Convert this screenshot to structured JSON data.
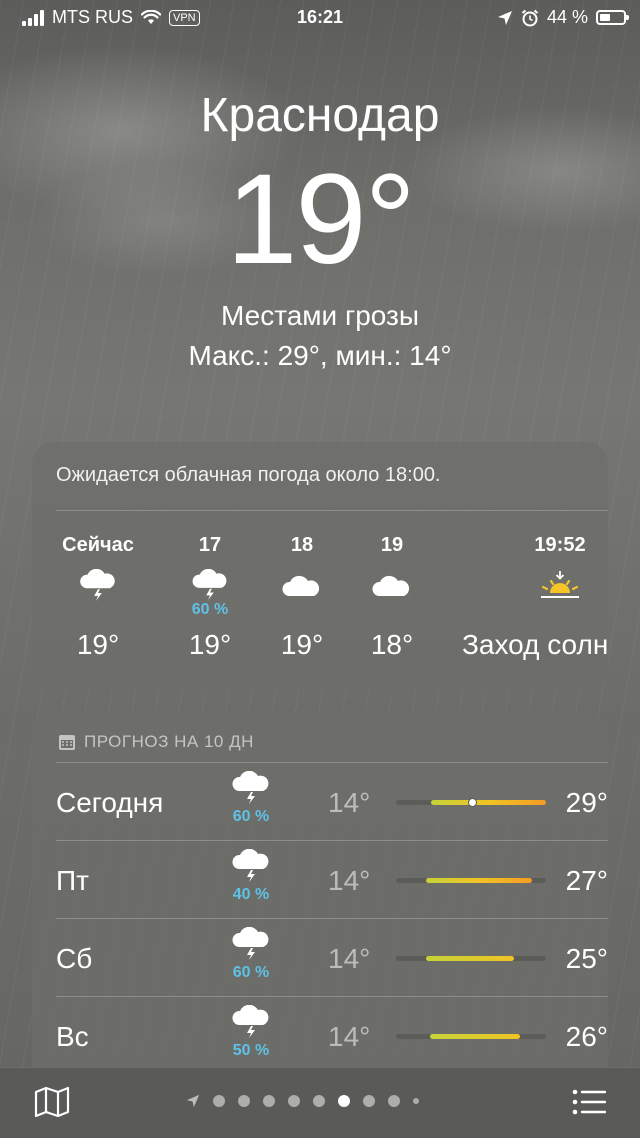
{
  "status": {
    "carrier": "MTS RUS",
    "vpn": "VPN",
    "time": "16:21",
    "battery": "44 %"
  },
  "current": {
    "city": "Краснодар",
    "temp": "19°",
    "condition": "Местами грозы",
    "hilo": "Макс.: 29°, мин.: 14°"
  },
  "hourly": {
    "summary": "Ожидается облачная погода около 18:00.",
    "items": [
      {
        "time": "Сейчас",
        "icon": "thunder-cloud-icon",
        "precip": "",
        "temp": "19°"
      },
      {
        "time": "17",
        "icon": "thunder-cloud-icon",
        "precip": "60 %",
        "temp": "19°"
      },
      {
        "time": "18",
        "icon": "cloud-icon",
        "precip": "",
        "temp": "19°"
      },
      {
        "time": "19",
        "icon": "cloud-icon",
        "precip": "",
        "temp": "18°"
      },
      {
        "time": "19:52",
        "icon": "sunset-icon",
        "precip": "",
        "temp": "Заход солнца"
      }
    ]
  },
  "tenday": {
    "header": "ПРОГНОЗ НА 10 ДН",
    "days": [
      {
        "day": "Сегодня",
        "precip": "60 %",
        "low": "14°",
        "high": "29°"
      },
      {
        "day": "Пт",
        "precip": "40 %",
        "low": "14°",
        "high": "27°"
      },
      {
        "day": "Сб",
        "precip": "60 %",
        "low": "14°",
        "high": "25°"
      },
      {
        "day": "Вс",
        "precip": "50 %",
        "low": "14°",
        "high": "26°"
      }
    ]
  },
  "colors": {
    "precip": "#5ec2e6",
    "range_start": "#c6d33a",
    "range_end": "#f59b25"
  }
}
